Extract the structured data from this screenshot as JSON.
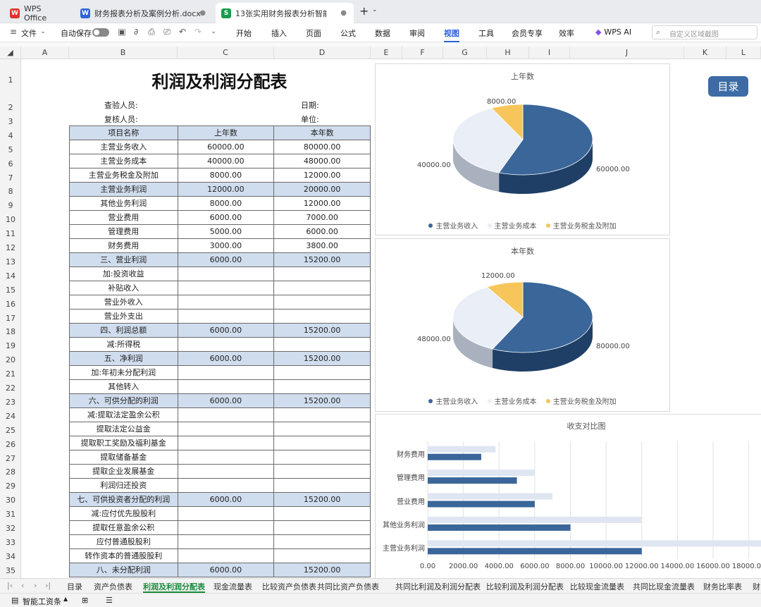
{
  "app": {
    "tabs": [
      {
        "label": "WPS Office",
        "icon": "wps-logo-icon"
      },
      {
        "label": "财务报表分析及案例分析.docx",
        "icon": "w-doc-icon"
      },
      {
        "label": "13张实用财务报表分析智能图",
        "icon": "s-sheet-icon"
      }
    ]
  },
  "menubar": {
    "file": "文件",
    "autosave": "自动保存",
    "menus": [
      "开始",
      "插入",
      "页面",
      "公式",
      "数据",
      "审阅",
      "视图",
      "工具",
      "会员专享",
      "效率"
    ],
    "active_menu": "视图",
    "wps_ai": "WPS AI",
    "search_placeholder": "自定义区域截图"
  },
  "columns": [
    "A",
    "B",
    "C",
    "D",
    "E",
    "F",
    "G",
    "H",
    "I",
    "J",
    "K",
    "L"
  ],
  "rows": [
    "1",
    "2",
    "3",
    "4",
    "5",
    "6",
    "7",
    "8",
    "9",
    "10",
    "11",
    "12",
    "13",
    "14",
    "15",
    "16",
    "17",
    "18",
    "19",
    "20",
    "21",
    "22",
    "23",
    "24",
    "25",
    "26",
    "27",
    "28",
    "29",
    "30",
    "31",
    "32",
    "33",
    "34",
    "35"
  ],
  "sheet": {
    "title": "利润及利润分配表",
    "reviewer_label": "查验人员:",
    "checker_label": "复核人员:",
    "date_label": "日期:",
    "unit_label": "单位:",
    "headers": [
      "项目名称",
      "上年数",
      "本年数"
    ],
    "rows": [
      {
        "name": "主营业务收入",
        "prev": "60000.00",
        "curr": "80000.00",
        "hl": false
      },
      {
        "name": "主营业务成本",
        "prev": "40000.00",
        "curr": "48000.00",
        "hl": false
      },
      {
        "name": "主营业务税金及附加",
        "prev": "8000.00",
        "curr": "12000.00",
        "hl": false
      },
      {
        "name": "主营业务利润",
        "prev": "12000.00",
        "curr": "20000.00",
        "hl": true
      },
      {
        "name": "其他业务利润",
        "prev": "8000.00",
        "curr": "12000.00",
        "hl": false
      },
      {
        "name": "营业费用",
        "prev": "6000.00",
        "curr": "7000.00",
        "hl": false
      },
      {
        "name": "管理费用",
        "prev": "5000.00",
        "curr": "6000.00",
        "hl": false
      },
      {
        "name": "财务费用",
        "prev": "3000.00",
        "curr": "3800.00",
        "hl": false
      },
      {
        "name": "三、营业利润",
        "prev": "6000.00",
        "curr": "15200.00",
        "hl": true
      },
      {
        "name": "加:投资收益",
        "prev": "",
        "curr": "",
        "hl": false
      },
      {
        "name": "补贴收入",
        "prev": "",
        "curr": "",
        "hl": false
      },
      {
        "name": "营业外收入",
        "prev": "",
        "curr": "",
        "hl": false
      },
      {
        "name": "营业外支出",
        "prev": "",
        "curr": "",
        "hl": false
      },
      {
        "name": "四、利润总额",
        "prev": "6000.00",
        "curr": "15200.00",
        "hl": true
      },
      {
        "name": "减:所得税",
        "prev": "",
        "curr": "",
        "hl": false
      },
      {
        "name": "五、净利润",
        "prev": "6000.00",
        "curr": "15200.00",
        "hl": true
      },
      {
        "name": "加:年初未分配利润",
        "prev": "",
        "curr": "",
        "hl": false
      },
      {
        "name": "其他转入",
        "prev": "",
        "curr": "",
        "hl": false
      },
      {
        "name": "六、可供分配的利润",
        "prev": "6000.00",
        "curr": "15200.00",
        "hl": true
      },
      {
        "name": "减:提取法定盈余公积",
        "prev": "",
        "curr": "",
        "hl": false
      },
      {
        "name": "提取法定公益金",
        "prev": "",
        "curr": "",
        "hl": false
      },
      {
        "name": "提取职工奖励及福利基金",
        "prev": "",
        "curr": "",
        "hl": false
      },
      {
        "name": "提取储备基金",
        "prev": "",
        "curr": "",
        "hl": false
      },
      {
        "name": "提取企业发展基金",
        "prev": "",
        "curr": "",
        "hl": false
      },
      {
        "name": "利润归还投资",
        "prev": "",
        "curr": "",
        "hl": false
      },
      {
        "name": "七、可供投资者分配的利润",
        "prev": "6000.00",
        "curr": "15200.00",
        "hl": true
      },
      {
        "name": "减:应付优先股股利",
        "prev": "",
        "curr": "",
        "hl": false
      },
      {
        "name": "提取任意盈余公积",
        "prev": "",
        "curr": "",
        "hl": false
      },
      {
        "name": "应付普通股股利",
        "prev": "",
        "curr": "",
        "hl": false
      },
      {
        "name": "转作资本的普通股股利",
        "prev": "",
        "curr": "",
        "hl": false
      },
      {
        "name": "八、未分配利润",
        "prev": "6000.00",
        "curr": "15200.00",
        "hl": true
      }
    ],
    "mulu_button": "目录"
  },
  "chart_data": [
    {
      "type": "pie",
      "title": "上年数",
      "categories": [
        "主营业务收入",
        "主营业务成本",
        "主营业务税金及附加"
      ],
      "values": [
        60000,
        40000,
        8000
      ],
      "labels": [
        "60000.00",
        "40000.00",
        "8000.00"
      ],
      "colors": [
        "#3a6699",
        "#e9eef7",
        "#f7c65a"
      ],
      "legend": "bottom"
    },
    {
      "type": "pie",
      "title": "本年数",
      "categories": [
        "主营业务收入",
        "主营业务成本",
        "主营业务税金及附加"
      ],
      "values": [
        80000,
        48000,
        12000
      ],
      "labels": [
        "80000.00",
        "48000.00",
        "12000.00"
      ],
      "colors": [
        "#3a6699",
        "#e9eef7",
        "#f7c65a"
      ],
      "legend": "bottom"
    },
    {
      "type": "bar",
      "title": "收支对比图",
      "categories": [
        "主营业务收入",
        "其他业务利润",
        "营业费用",
        "管理费用",
        "财务费用"
      ],
      "category_labels": [
        "主营业务利润",
        "其他业务利润",
        "营业费用",
        "管理费用",
        "财务费用"
      ],
      "series": [
        {
          "name": "上年数",
          "values": [
            12000,
            8000,
            6000,
            5000,
            3000
          ],
          "color": "#3a6699"
        },
        {
          "name": "本年数",
          "values": [
            20000,
            12000,
            7000,
            6000,
            3800
          ],
          "color": "#dfe6f2"
        }
      ],
      "xticks": [
        "0.00",
        "2000.00",
        "4000.00",
        "6000.00",
        "8000.00",
        "10000.00",
        "12000.00",
        "14000.00",
        "16000.00",
        "18000.00"
      ],
      "xlim": [
        0,
        19000
      ],
      "grid": true
    }
  ],
  "sheettabs": {
    "tabs": [
      "目录",
      "资产负债表",
      "利润及利润分配表",
      "现金流量表",
      "比较资产负债表",
      "共同比资产负债表",
      "共同比利润及利润分配表",
      "比较利润及利润分配表",
      "比较现金流量表",
      "共同比现金流量表",
      "财务比率表",
      "财"
    ],
    "active": "利润及利润分配表"
  },
  "statusbar": {
    "label": "智能工资条"
  }
}
